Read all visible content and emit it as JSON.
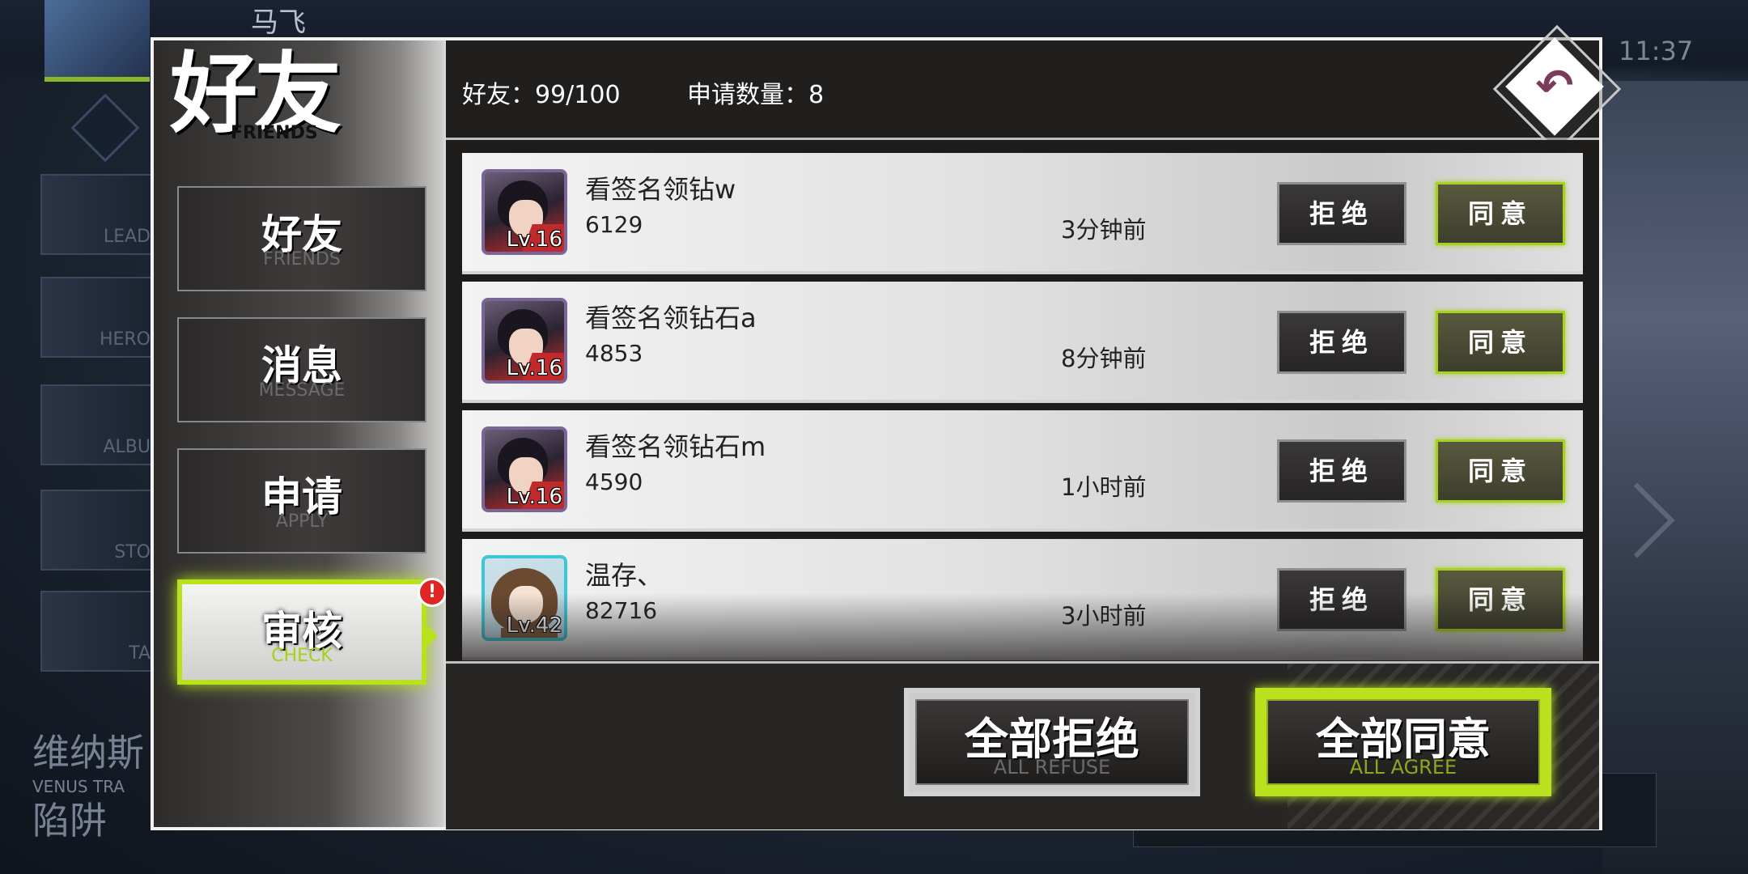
{
  "background": {
    "player_name": "马飞",
    "clock": "11:37",
    "menu_items": [
      "LEAD",
      "HERO",
      "ALBU",
      "STO",
      "TA"
    ],
    "bottom_left_text": [
      "维纳斯",
      "VENUS TRA",
      "陷阱"
    ]
  },
  "dialog": {
    "title": "好友",
    "title_sub": "FRIENDS"
  },
  "sidebar": {
    "tabs": [
      {
        "label": "好友",
        "sub": "FRIENDS"
      },
      {
        "label": "消息",
        "sub": "MESSAGE"
      },
      {
        "label": "申请",
        "sub": "APPLY"
      },
      {
        "label": "审核",
        "sub": "CHECK"
      }
    ],
    "active_tab": "审核",
    "alert_badge": "!"
  },
  "header": {
    "friends_label": "好友：",
    "friends_count": "99/100",
    "requests_label": "申请数量：",
    "requests_count": "8"
  },
  "requests": [
    {
      "name": "看签名领钻w",
      "id": "6129",
      "level": "Lv.16",
      "time": "3分钟前",
      "avatar": "red-cape-hero"
    },
    {
      "name": "看签名领钻石a",
      "id": "4853",
      "level": "Lv.16",
      "time": "8分钟前",
      "avatar": "red-cape-hero"
    },
    {
      "name": "看签名领钻石m",
      "id": "4590",
      "level": "Lv.16",
      "time": "1小时前",
      "avatar": "red-cape-hero"
    },
    {
      "name": "温存、",
      "id": "82716",
      "level": "Lv.42",
      "time": "3小时前",
      "avatar": "glasses-girl"
    }
  ],
  "row_buttons": {
    "refuse": "拒绝",
    "agree": "同意"
  },
  "footer": {
    "refuse_all": "全部拒绝",
    "refuse_all_sub": "ALL REFUSE",
    "agree_all": "全部同意",
    "agree_all_sub": "ALL AGREE"
  },
  "icons": {
    "back": "undo-arrow-icon",
    "alert": "exclamation-icon"
  },
  "colors": {
    "accent": "#b7e21d",
    "refuse_border": "#8f8f8f",
    "alert": "#e02525",
    "avatar_frame_purple": "#7a6598",
    "avatar_frame_teal": "#3cc7d6"
  }
}
